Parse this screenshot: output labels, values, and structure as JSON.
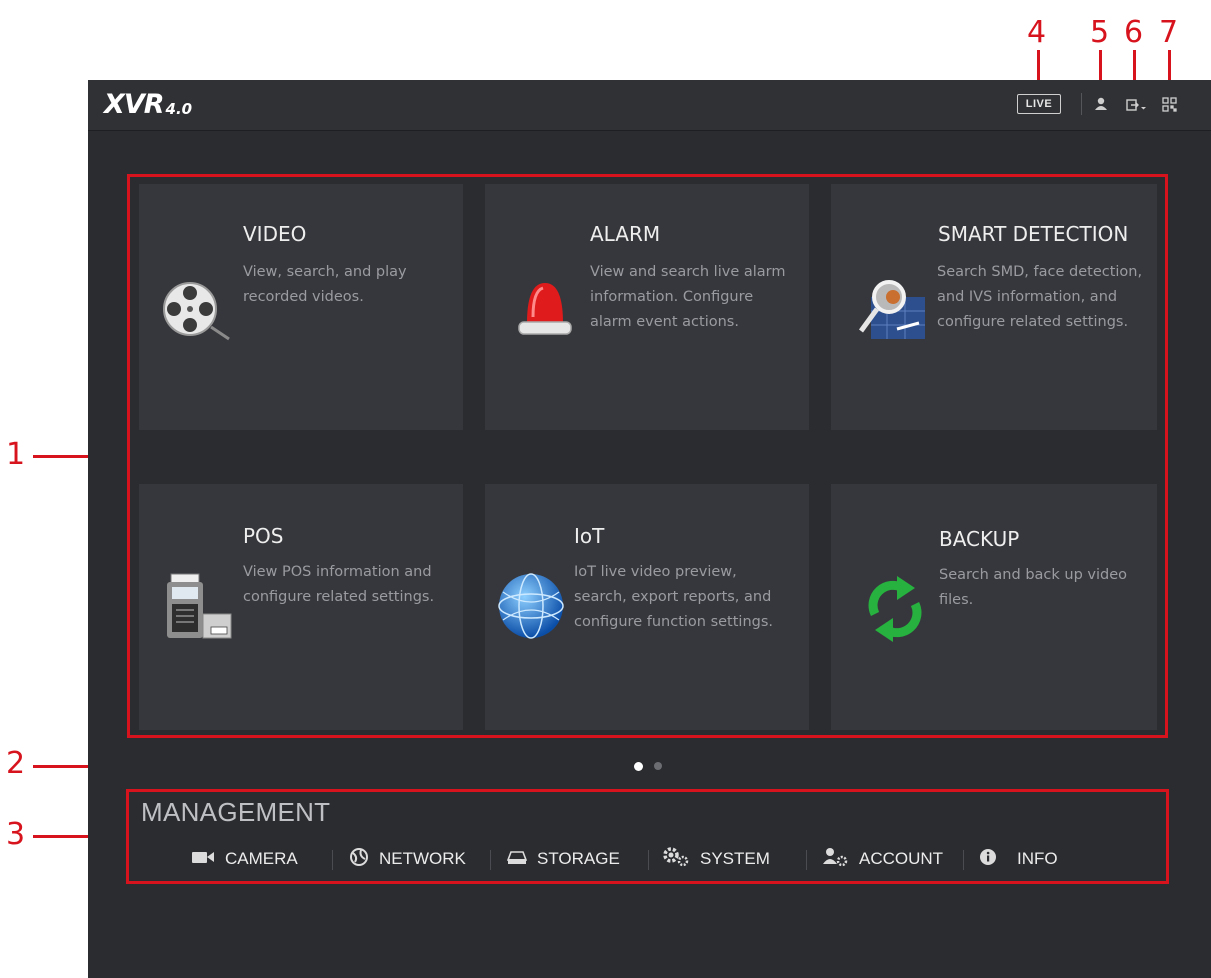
{
  "callouts": [
    "1",
    "2",
    "3",
    "4",
    "5",
    "6",
    "7"
  ],
  "app": {
    "logo_main": "XVR",
    "logo_version": "4.0"
  },
  "topbar": {
    "live_label": "LIVE",
    "icons": [
      "user-icon",
      "logout-dropdown-icon",
      "qr-code-icon"
    ]
  },
  "tiles": [
    {
      "title": "VIDEO",
      "desc": "View, search, and play recorded videos.",
      "icon": "film-reel-icon"
    },
    {
      "title": "ALARM",
      "desc": "View and search live alarm information. Configure alarm event actions.",
      "icon": "alarm-light-icon"
    },
    {
      "title": "SMART DETECTION",
      "desc": "Search SMD, face detection, and IVS information, and configure related settings.",
      "icon": "magnifier-icon"
    },
    {
      "title": "POS",
      "desc": "View POS information and configure related settings.",
      "icon": "pos-terminal-icon"
    },
    {
      "title": "IoT",
      "desc": "IoT live video preview, search, export reports, and configure function settings.",
      "icon": "globe-icon"
    },
    {
      "title": "BACKUP",
      "desc": "Search and back up video files.",
      "icon": "sync-icon"
    }
  ],
  "pager": {
    "pages": 2,
    "active": 1
  },
  "management": {
    "title": "MANAGEMENT",
    "items": [
      {
        "label": "CAMERA",
        "icon": "camera-icon"
      },
      {
        "label": "NETWORK",
        "icon": "network-globe-icon"
      },
      {
        "label": "STORAGE",
        "icon": "hard-disk-icon"
      },
      {
        "label": "SYSTEM",
        "icon": "gears-icon"
      },
      {
        "label": "ACCOUNT",
        "icon": "account-gear-icon"
      },
      {
        "label": "INFO",
        "icon": "info-icon"
      }
    ]
  },
  "colors": {
    "accent_red": "#d7141e",
    "background": "#2b2c30",
    "tile": "#36373c"
  }
}
